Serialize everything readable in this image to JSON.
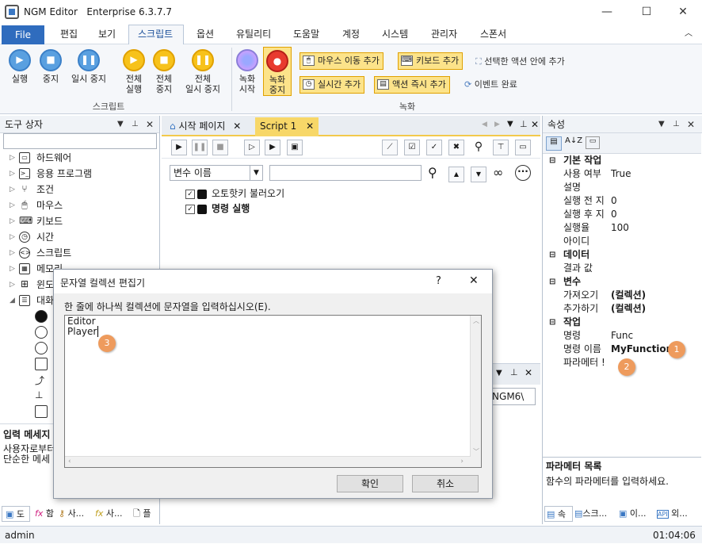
{
  "window": {
    "app_name": "NGM Editor",
    "edition": "Enterprise 6.3.7.7",
    "minimize": "—",
    "maximize": "☐",
    "close": "✕"
  },
  "menu": {
    "file": "File",
    "items": [
      "편집",
      "보기",
      "스크립트",
      "옵션",
      "유틸리티",
      "도움말",
      "계정",
      "시스템",
      "관리자",
      "스폰서"
    ],
    "active": "스크립트"
  },
  "ribbon": {
    "script_group": "스크립트",
    "run": "실행",
    "stop": "중지",
    "pause": "일시 중지",
    "all_run": [
      "전체",
      "실행"
    ],
    "all_stop": [
      "전체",
      "중지"
    ],
    "all_pause": [
      "전체",
      "일시 중지"
    ],
    "record_group": "녹화",
    "rec_start": [
      "녹화",
      "시작"
    ],
    "rec_stop": [
      "녹화",
      "중지"
    ],
    "add_mouse_move": "마우스 이동 추가",
    "add_keyboard": "키보드 추가",
    "add_into_selected": "선택한 액션 안에 추가",
    "add_realtime": "실시간 추가",
    "add_action_immediate": "액션 즉시 추가",
    "event_complete": "이벤트 완료"
  },
  "left_panel": {
    "title": "도구 상자",
    "search_placeholder": "",
    "tree": [
      {
        "label": "하드웨어",
        "icon": "laptop-icon"
      },
      {
        "label": "응용 프로그램",
        "icon": "terminal-icon"
      },
      {
        "label": "조건",
        "icon": "branch-icon"
      },
      {
        "label": "마우스",
        "icon": "mouse-icon"
      },
      {
        "label": "키보드",
        "icon": "keyboard-icon"
      },
      {
        "label": "시간",
        "icon": "clock-icon"
      },
      {
        "label": "스크립트",
        "icon": "code-icon"
      },
      {
        "label": "메모리",
        "icon": "memory-icon"
      },
      {
        "label": "윈도",
        "icon": "windows-icon"
      },
      {
        "label": "대화",
        "icon": "dialog-icon"
      }
    ],
    "desc_title": "입력 메세지",
    "desc_text": [
      "사용자로부터",
      "단순한 메세"
    ],
    "bottom_tabs": [
      "도",
      "함",
      "사...",
      "사...",
      "플"
    ]
  },
  "doc_tabs": [
    {
      "label": "시작 페이지"
    },
    {
      "label": "Script 1"
    }
  ],
  "script": {
    "var_select": "변수 이름",
    "search_value": "",
    "rows": [
      {
        "label": "오토핫키 불러오기",
        "bold": false
      },
      {
        "label": "명령 실행",
        "bold": true
      }
    ]
  },
  "output_path": "\\NGM6\\",
  "right_panel": {
    "title": "속성",
    "categories": [
      {
        "name": "기본 작업",
        "props": [
          {
            "k": "사용 여부",
            "v": "True"
          },
          {
            "k": "설명",
            "v": ""
          },
          {
            "k": "실행 전 지",
            "v": "0"
          },
          {
            "k": "실행 후 지",
            "v": "0"
          },
          {
            "k": "실행율",
            "v": "100"
          },
          {
            "k": "아이디",
            "v": ""
          }
        ]
      },
      {
        "name": "데이터",
        "props": [
          {
            "k": "결과 값",
            "v": ""
          }
        ]
      },
      {
        "name": "변수",
        "props": [
          {
            "k": "가져오기",
            "v": "(컬렉션)"
          },
          {
            "k": "추가하기",
            "v": "(컬렉션)"
          }
        ]
      },
      {
        "name": "작업",
        "props": [
          {
            "k": "명령",
            "v": "Func"
          },
          {
            "k": "명령 이름",
            "v": "MyFunction"
          },
          {
            "k": "파라메터 !",
            "v": ""
          }
        ]
      }
    ],
    "desc_title": "파라메터 목록",
    "desc_text": "함수의 파라메터를 입력하세요.",
    "bottom_tabs": [
      "속",
      "스크...",
      "이...",
      "외..."
    ]
  },
  "dialog": {
    "title": "문자열 컬렉션 편집기",
    "help": "?",
    "close": "✕",
    "instruction": "한 줄에 하나씩 컬렉션에 문자열을 입력하십시오(E).",
    "lines": [
      "Editor",
      "Player"
    ],
    "ok": "확인",
    "cancel": "취소"
  },
  "status": {
    "user": "admin",
    "time": "01:04:06"
  },
  "badges": [
    "1",
    "2",
    "3"
  ],
  "colors": {
    "accent": "#2f6cbe",
    "highlight": "#f2c94c",
    "badge": "#ee9b5d"
  }
}
